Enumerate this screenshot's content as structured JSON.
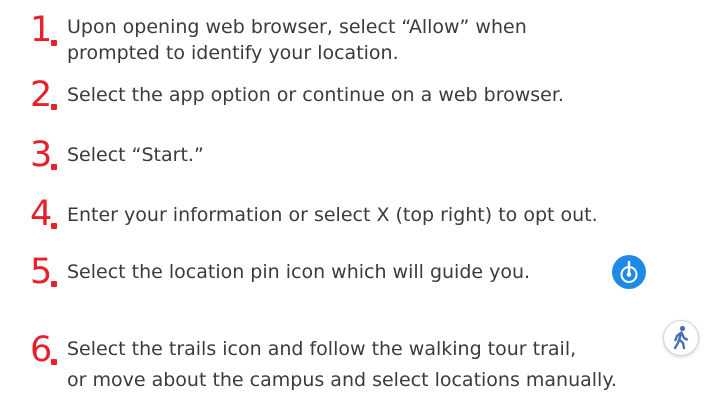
{
  "steps": [
    {
      "number": "1",
      "lines": [
        "Upon opening web browser, select “Allow” when",
        "prompted to identify your location."
      ]
    },
    {
      "number": "2",
      "lines": [
        "Select the app option or continue on a web browser."
      ]
    },
    {
      "number": "3",
      "lines": [
        "Select “Start.”"
      ]
    },
    {
      "number": "4",
      "lines": [
        "Enter your information or select X (top right) to opt out."
      ]
    },
    {
      "number": "5",
      "lines": [
        "Select the location pin icon which will guide you."
      ],
      "icon": "location-pin-icon"
    },
    {
      "number": "6",
      "lines": [
        "Select the trails icon and follow the walking tour trail,",
        "or move about the campus and select locations manually."
      ],
      "icon": "walking-person-icon"
    }
  ],
  "colors": {
    "number": "#e8202a",
    "text": "#3b3b3b",
    "pin_icon_bg": "#1f8ae6",
    "trail_icon_fg": "#4a6fb5"
  }
}
